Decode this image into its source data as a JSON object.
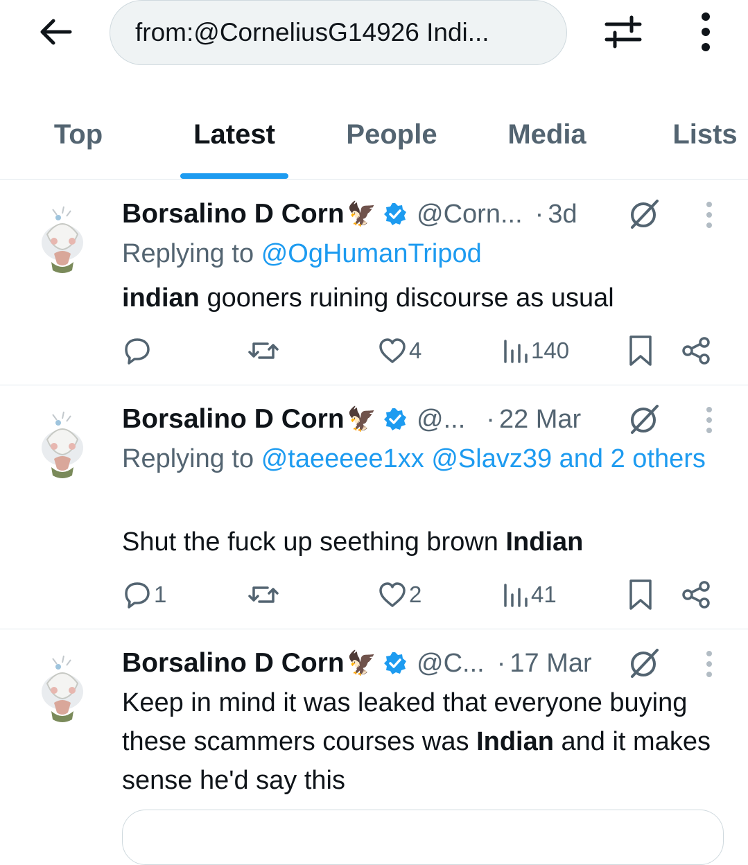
{
  "search": {
    "value": "from:@CorneliusG14926 Indi..."
  },
  "tabs": [
    {
      "label": "Top"
    },
    {
      "label": "Latest",
      "active": true
    },
    {
      "label": "People"
    },
    {
      "label": "Media"
    },
    {
      "label": "Lists"
    }
  ],
  "tweets": [
    {
      "name": "Borsalino D Corn",
      "emoji": "🦅",
      "handle": "@Corn...",
      "time": "3d",
      "reply_prefix": "Replying to",
      "mentions": [
        "@OgHumanTripod"
      ],
      "body_bold": "indian",
      "body_rest": " gooners ruining discourse as usual",
      "replies": "",
      "retweets": "",
      "likes": "4",
      "views": "140"
    },
    {
      "name": "Borsalino D Corn",
      "emoji": "🦅",
      "handle": "@...",
      "time": "22 Mar",
      "reply_prefix": "Replying to",
      "mentions": [
        "@taeeeee1xx",
        "@Slavz39",
        "and 2 others"
      ],
      "body_plain": "Shut the fuck up seething brown ",
      "body_bold": "Indian",
      "replies": "1",
      "retweets": "",
      "likes": "2",
      "views": "41"
    },
    {
      "name": "Borsalino D Corn",
      "emoji": "🦅",
      "handle": "@C...",
      "time": "17 Mar",
      "body_plain": "Keep in mind it was leaked that everyone buying these scammers courses was ",
      "body_bold": "Indian",
      "body_rest": " and it makes sense he'd say this"
    }
  ],
  "icons": {
    "back": "arrow-left-icon",
    "filter": "sliders-icon",
    "more": "vertical-dots-icon",
    "verified": "verified-badge-icon",
    "grok": "grok-icon",
    "reply": "speech-bubble-icon",
    "retweet": "retweet-icon",
    "like": "heart-icon",
    "views": "bar-chart-icon",
    "bookmark": "bookmark-icon",
    "share": "share-icon"
  },
  "colors": {
    "accent": "#1d9bf0",
    "text": "#0f1419",
    "muted": "#536471",
    "border": "#e1e8ed"
  }
}
